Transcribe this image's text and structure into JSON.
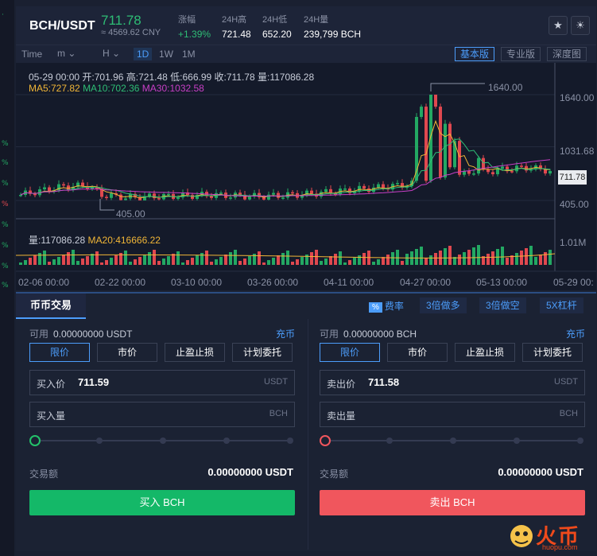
{
  "header": {
    "pair": "BCH/USDT",
    "price": "711.78",
    "cny": "≈ 4569.62 CNY",
    "stats": [
      {
        "label": "涨幅",
        "value": "+1.39%"
      },
      {
        "label": "24H高",
        "value": "721.48"
      },
      {
        "label": "24H低",
        "value": "652.20"
      },
      {
        "label": "24H量",
        "value": "239,799 BCH"
      }
    ]
  },
  "toolbar": {
    "time": "Time",
    "minute": "m",
    "hour": "H",
    "intervals": [
      "1D",
      "1W",
      "1M"
    ],
    "active_interval": "1D",
    "views": [
      "基本版",
      "专业版",
      "深度图"
    ]
  },
  "chart": {
    "ohlc": "05-29 00:00  开:701.96  高:721.48  低:666.99  收:711.78  量:117086.28",
    "ma5": "MA5:727.82",
    "ma10": "MA10:702.36",
    "ma30": "MA30:1032.58",
    "y_labels": [
      "1640.00",
      "1031.68",
      "405.00"
    ],
    "current_price": "711.78",
    "high_marker": "1640.00",
    "low_marker": "405.00",
    "vol_label": "量:117086.28",
    "vol_ma20": "MA20:416666.22",
    "vol_axis": "1.01M",
    "x_labels": [
      "02-06 00:00",
      "02-22 00:00",
      "03-10 00:00",
      "03-26 00:00",
      "04-11 00:00",
      "04-27 00:00",
      "05-13 00:00",
      "05-29 00:"
    ],
    "colors": {
      "up": "#23a863",
      "down": "#e0484f",
      "ma5": "#f1b637",
      "ma10": "#2ebd75",
      "ma30": "#c83fc6"
    }
  },
  "chart_data": {
    "type": "candlestick",
    "x_range": [
      "02-06",
      "05-29"
    ],
    "ylim": [
      405,
      1640
    ],
    "high": 1640.0,
    "low": 405.0,
    "last": {
      "date": "05-29",
      "open": 701.96,
      "high": 721.48,
      "low": 666.99,
      "close": 711.78,
      "volume": 117086.28
    }
  },
  "trade": {
    "tab": "币币交易",
    "fee_badge": "%",
    "fee": "费率",
    "leverage": [
      "3倍做多",
      "3倍做空",
      "5X杠杆"
    ],
    "buy": {
      "avail_label": "可用",
      "avail": "0.00000000 USDT",
      "charge": "充币",
      "types": [
        "限价",
        "市价",
        "止盈止损",
        "计划委托"
      ],
      "price_label": "买入价",
      "price": "711.59",
      "price_unit": "USDT",
      "qty_label": "买入量",
      "qty_unit": "BCH",
      "amount_label": "交易额",
      "amount": "0.00000000 USDT",
      "button": "买入 BCH"
    },
    "sell": {
      "avail_label": "可用",
      "avail": "0.00000000 BCH",
      "charge": "充币",
      "types": [
        "限价",
        "市价",
        "止盈止损",
        "计划委托"
      ],
      "price_label": "卖出价",
      "price": "711.58",
      "price_unit": "USDT",
      "qty_label": "卖出量",
      "qty_unit": "BCH",
      "amount_label": "交易额",
      "amount": "0.00000000 USDT",
      "button": "卖出 BCH"
    }
  },
  "watermark": {
    "text": "火币",
    "sub": "huopu.com"
  }
}
